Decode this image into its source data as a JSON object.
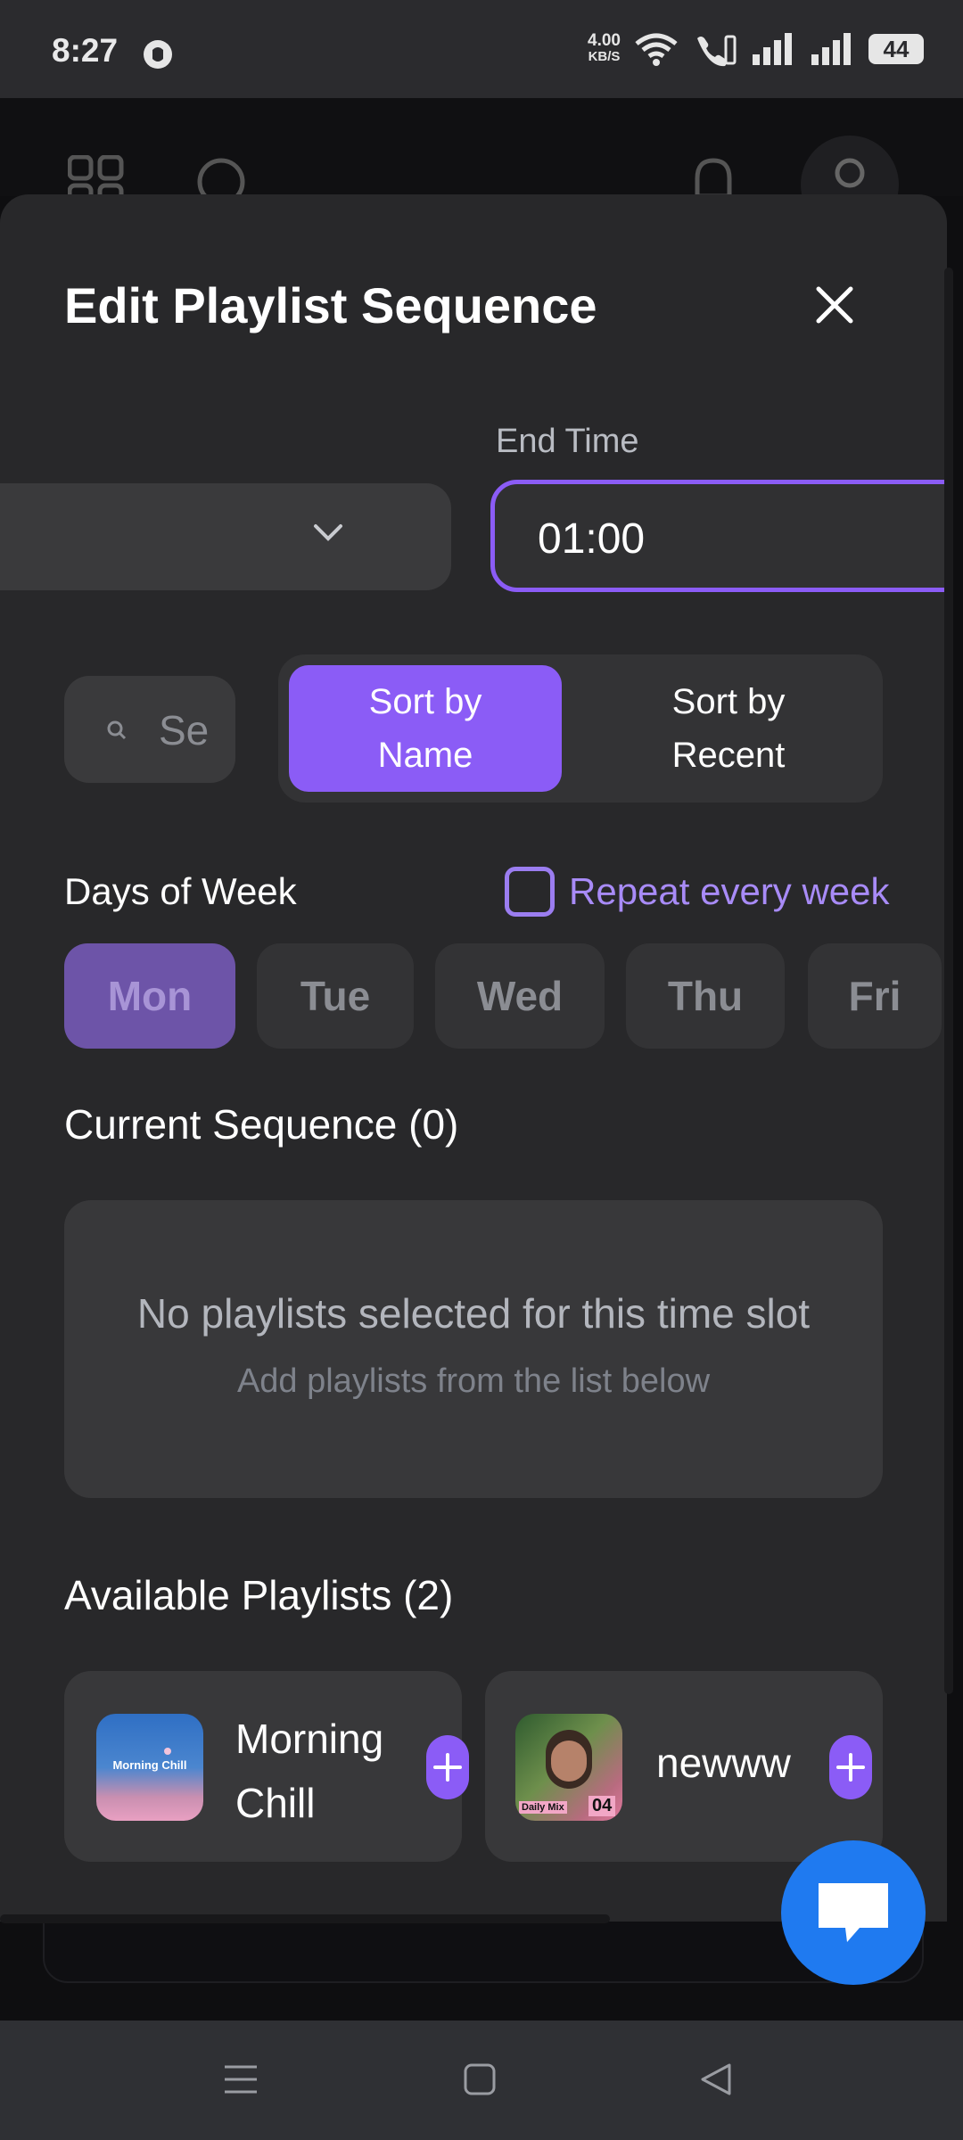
{
  "status": {
    "time": "8:27",
    "net_speed_value": "4.00",
    "net_speed_unit": "KB/S",
    "battery": "44"
  },
  "modal": {
    "title": "Edit Playlist Sequence",
    "end_time_label": "End Time",
    "end_time_value": "01:00",
    "search_placeholder": "Se",
    "sort_by_name": "Sort by Name",
    "sort_by_recent": "Sort by Recent",
    "days_label": "Days of Week",
    "repeat_label": "Repeat every week",
    "days": [
      "Mon",
      "Tue",
      "Wed",
      "Thu",
      "Fri"
    ],
    "selected_day": "Mon",
    "current_sequence_title": "Current Sequence (0)",
    "empty_title": "No playlists selected for this time slot",
    "empty_subtitle": "Add playlists from the list below",
    "available_title": "Available Playlists (2)",
    "playlists": [
      {
        "name": "Morning Chill",
        "thumb_text": "Morning Chill"
      },
      {
        "name": "newww",
        "thumb_text_left": "Daily Mix",
        "thumb_text_right": "04"
      }
    ]
  },
  "colors": {
    "accent": "#8b5cf6",
    "modal_bg": "#28282a",
    "chat_fab": "#1f7af0"
  }
}
